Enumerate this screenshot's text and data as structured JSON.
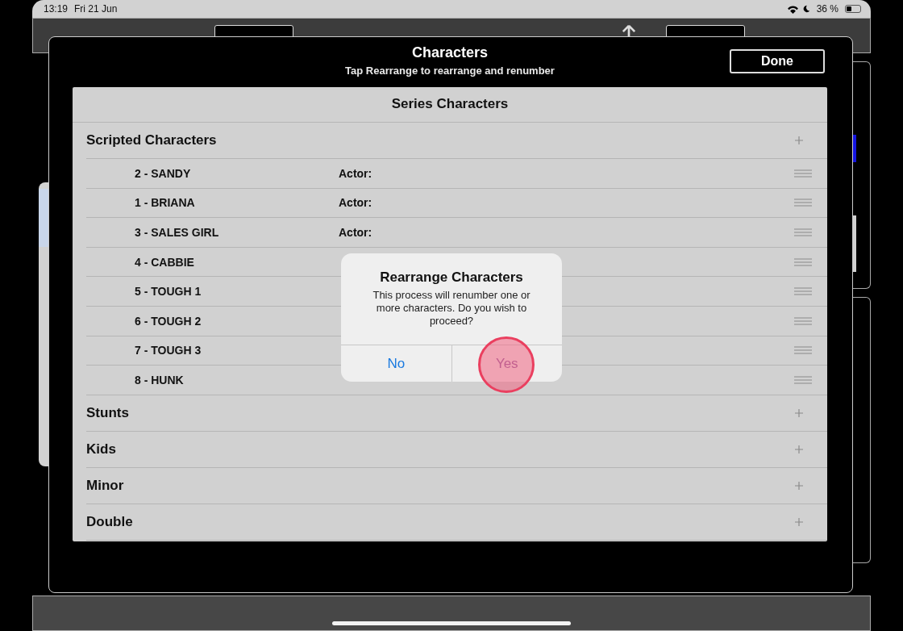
{
  "status_bar": {
    "time": "13:19",
    "date": "Fri 21 Jun",
    "battery": "36 %"
  },
  "modal": {
    "title": "Characters",
    "subtitle": "Tap Rearrange to rearrange and renumber",
    "done_button": "Done"
  },
  "panel": {
    "title": "Series Characters",
    "sections": [
      {
        "name": "Scripted Characters",
        "characters": [
          {
            "name": "2 - SANDY",
            "actor_label": "Actor:"
          },
          {
            "name": "1 - BRIANA",
            "actor_label": "Actor:"
          },
          {
            "name": "3 - SALES GIRL",
            "actor_label": "Actor:"
          },
          {
            "name": "4 - CABBIE"
          },
          {
            "name": "5 - TOUGH 1"
          },
          {
            "name": "6 - TOUGH 2"
          },
          {
            "name": "7 - TOUGH 3"
          },
          {
            "name": "8 - HUNK"
          }
        ]
      },
      {
        "name": "Stunts"
      },
      {
        "name": "Kids"
      },
      {
        "name": "Minor"
      },
      {
        "name": "Double"
      }
    ]
  },
  "alert": {
    "title": "Rearrange Characters",
    "message": "This process will renumber one or more characters. Do you wish to proceed?",
    "buttons": [
      {
        "label": "No",
        "touched": false
      },
      {
        "label": "Yes",
        "touched": true
      }
    ]
  }
}
